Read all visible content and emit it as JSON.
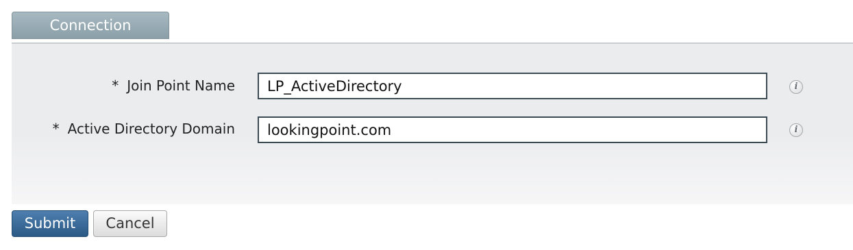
{
  "tabs": {
    "active_label": "Connection"
  },
  "form": {
    "join_point": {
      "required_mark": "*",
      "label": "Join Point Name",
      "value": "LP_ActiveDirectory"
    },
    "ad_domain": {
      "required_mark": "*",
      "label": "Active Directory Domain",
      "value": "lookingpoint.com"
    },
    "info_glyph": "i"
  },
  "actions": {
    "submit_label": "Submit",
    "cancel_label": "Cancel"
  },
  "colors": {
    "tab_background": "#94a8b1",
    "submit_background": "#3b6c99",
    "field_border": "#3b4a52",
    "panel_background": "#ebecee"
  }
}
